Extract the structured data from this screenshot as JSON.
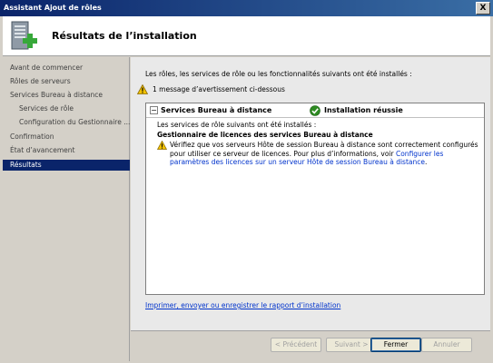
{
  "window": {
    "title": "Assistant Ajout de rôles",
    "close_glyph": "X"
  },
  "header": {
    "title": "Résultats de l’installation",
    "icon": "server-roles-add-icon"
  },
  "sidebar": {
    "items": [
      {
        "label": "Avant de commencer",
        "sub": false,
        "active": false
      },
      {
        "label": "Rôles de serveurs",
        "sub": false,
        "active": false
      },
      {
        "label": "Services Bureau à distance",
        "sub": false,
        "active": false
      },
      {
        "label": "Services de rôle",
        "sub": true,
        "active": false
      },
      {
        "label": "Configuration du Gestionnaire ...",
        "sub": true,
        "active": false
      },
      {
        "label": "Confirmation",
        "sub": false,
        "active": false
      },
      {
        "label": "État d’avancement",
        "sub": false,
        "active": false
      },
      {
        "label": "Résultats",
        "sub": false,
        "active": true
      }
    ]
  },
  "main": {
    "intro": "Les rôles, les services de rôle ou les fonctionnalités suivants ont été installés :",
    "warning_summary": "1 message d’avertissement ci-dessous",
    "results": {
      "collapse_glyph": "−",
      "service_name": "Services Bureau à distance",
      "status": "Installation réussie",
      "installed_label": "Les services de rôle suivants ont été installés :",
      "role_name": "Gestionnaire de licences des services Bureau à distance",
      "note_text": "Vérifiez que vos serveurs Hôte de session Bureau à distance sont correctement configurés pour utiliser ce serveur de licences. Pour plus d’informations, voir ",
      "note_link": "Configurer les paramètres des licences sur un serveur Hôte de session Bureau à distance",
      "note_end": "."
    },
    "report_link": "Imprimer, envoyer ou enregistrer le rapport d’installation"
  },
  "buttons": {
    "previous": "< Précédent",
    "next": "Suivant >",
    "close": "Fermer",
    "cancel": "Annuler"
  },
  "colors": {
    "title_bar": "#0a246a",
    "selection": "#0a246a",
    "link": "#0033cc",
    "success": "#2e8b22",
    "warning": "#f2c200"
  }
}
